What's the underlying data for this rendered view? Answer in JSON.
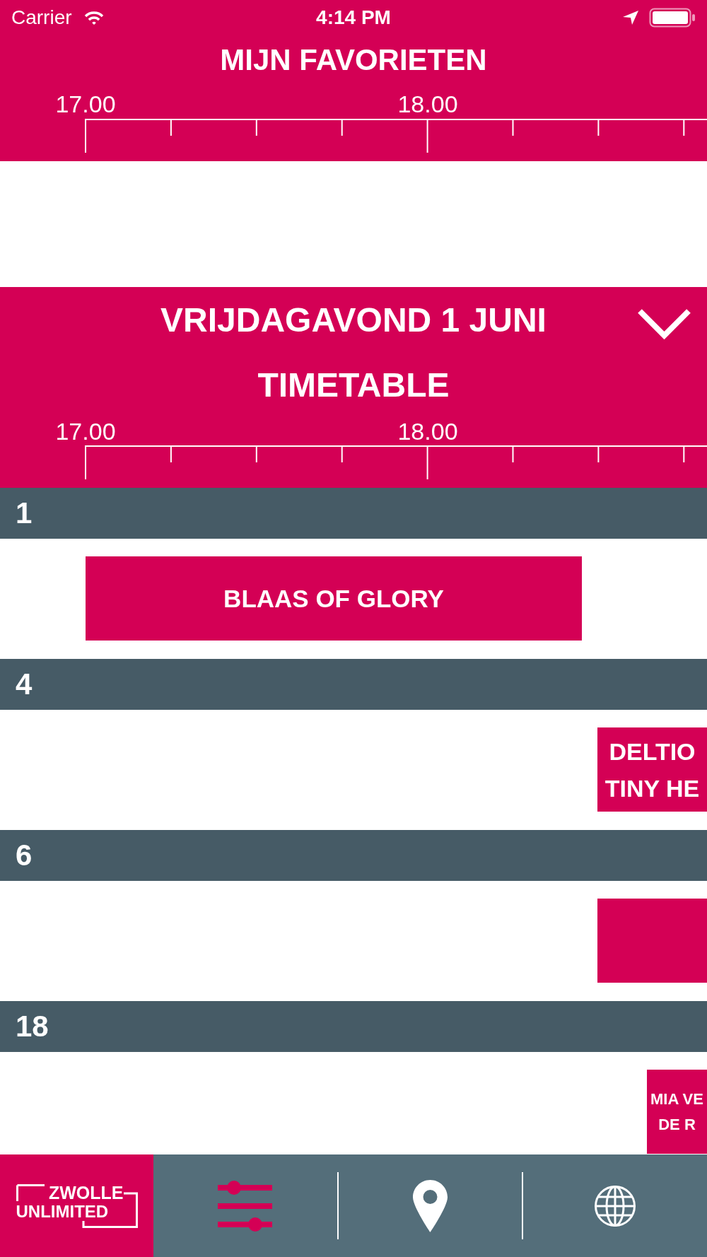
{
  "status_bar": {
    "carrier": "Carrier",
    "time": "4:14 PM"
  },
  "favorites": {
    "title": "MIJN FAVORIETEN",
    "timeline": [
      "17.00",
      "18.00"
    ]
  },
  "timetable": {
    "day": "VRIJDAGAVOND 1 JUNI",
    "title": "TIMETABLE",
    "timeline": [
      "17.00",
      "18.00"
    ],
    "stages": [
      {
        "name": "1",
        "events": [
          {
            "kind": "act",
            "lines": [
              "BLAAS OF GLORY"
            ]
          }
        ]
      },
      {
        "name": "4",
        "events": [
          {
            "kind": "act",
            "lines": [
              "DELTIO",
              "TINY HE"
            ]
          }
        ]
      },
      {
        "name": "6",
        "events": [
          {
            "kind": "act"
          }
        ]
      },
      {
        "name": "18",
        "events": [
          {
            "kind": "act",
            "lines": [
              "MIA VE",
              "DE R"
            ]
          }
        ]
      }
    ]
  },
  "tab_bar": {
    "logo": {
      "lines": [
        "ZWOLLE",
        "UNLIMITED"
      ]
    },
    "tabs": [
      {
        "selected": true
      },
      {
        "selected": false
      },
      {
        "selected": false
      }
    ]
  }
}
